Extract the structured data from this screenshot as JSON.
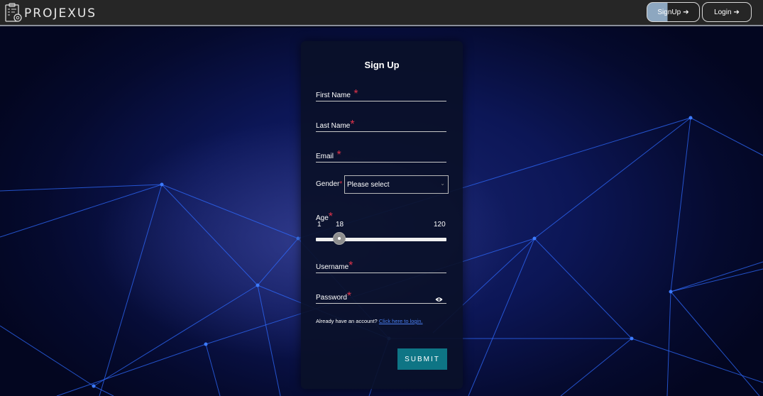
{
  "app": {
    "name": "PROJEXUS",
    "logo_icon": "clipboard-gear-icon"
  },
  "nav": {
    "signup_label": "SignUp",
    "login_label": "Login",
    "signup_icon": "sign-in-arrow-icon",
    "login_icon": "sign-in-arrow-icon"
  },
  "form": {
    "title": "Sign Up",
    "first_name_label": "First Name",
    "last_name_label": "Last Name",
    "email_label": "Email",
    "gender_label": "Gender",
    "gender_value": "Please select",
    "age_label": "Age",
    "age_min": "1",
    "age_value": "18",
    "age_max": "120",
    "username_label": "Username",
    "password_label": "Password",
    "required_marker": "*",
    "account_prompt": "Already have an account?",
    "login_link": "Click here to login.",
    "submit_label": "SUBMIT"
  },
  "colors": {
    "topbar": "#262626",
    "card": "#0a1028",
    "submit": "#0e7585",
    "required": "#e0334a",
    "link": "#4a7ff0",
    "network_lines": "#2f6bff"
  }
}
